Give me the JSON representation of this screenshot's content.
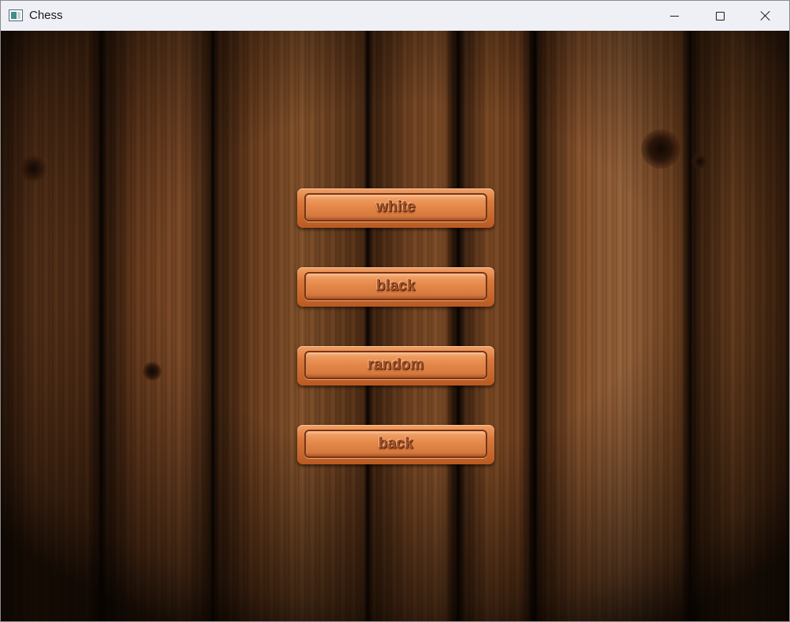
{
  "window": {
    "title": "Chess",
    "icons": {
      "app": "window-app-icon",
      "minimize": "minimize-icon",
      "maximize": "maximize-icon",
      "close": "close-icon"
    }
  },
  "menu": {
    "buttons": [
      {
        "id": "white",
        "label": "white"
      },
      {
        "id": "black",
        "label": "black"
      },
      {
        "id": "random",
        "label": "random"
      },
      {
        "id": "back",
        "label": "back"
      }
    ]
  },
  "colors": {
    "button_face": "#e5894a",
    "button_border": "#7a3512",
    "label_text": "#a2542a",
    "background_wood": "#6e3f1f"
  }
}
